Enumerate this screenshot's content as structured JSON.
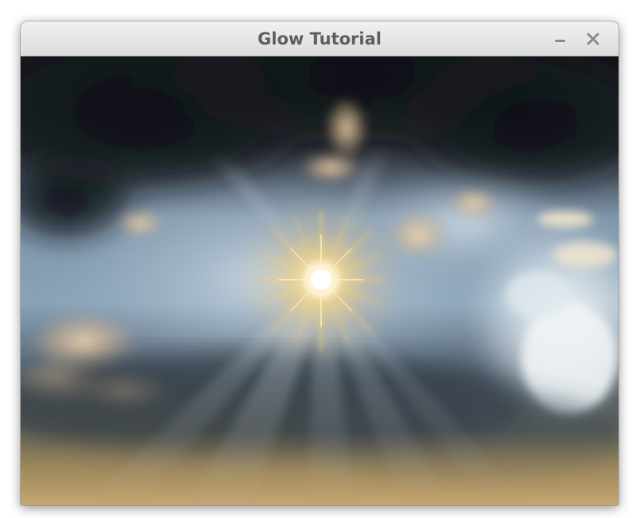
{
  "window": {
    "title": "Glow Tutorial",
    "controls": {
      "minimize_icon": "minimize-icon",
      "close_icon": "close-icon"
    }
  },
  "scene": {
    "subject": "sun-glow",
    "colors": {
      "sky_dark": "#15171c",
      "sky_blue": "#9fb7cc",
      "cloud_light": "#e9eef2",
      "sun_core": "#ffffff",
      "sun_glow": "#f3c15a",
      "horizon": "#b79a62"
    }
  }
}
